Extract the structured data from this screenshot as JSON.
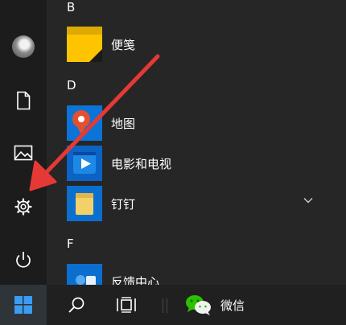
{
  "start_menu": {
    "sections": [
      {
        "letter": "B",
        "apps": [
          {
            "label": "便笺",
            "icon": "sticky-notes-icon",
            "tile_color": "#ffc400"
          }
        ]
      },
      {
        "letter": "D",
        "apps": [
          {
            "label": "地图",
            "icon": "maps-icon",
            "tile_color": "#0b74d6"
          },
          {
            "label": "电影和电视",
            "icon": "movies-tv-icon",
            "tile_color": "#0b63c5"
          },
          {
            "label": "钉钉",
            "icon": "folder-icon",
            "tile_color": "#0b6fd0",
            "expandable": true
          }
        ]
      },
      {
        "letter": "F",
        "apps": [
          {
            "label": "反馈中心",
            "icon": "feedback-hub-icon",
            "tile_color": "#0b6fd0"
          }
        ]
      }
    ]
  },
  "left_rail": [
    "user-avatar",
    "documents-icon",
    "pictures-icon",
    "settings-icon",
    "power-icon"
  ],
  "taskbar": {
    "wechat_label": "微信"
  },
  "annotation": {
    "color": "#e53935",
    "points_to": "settings-icon"
  }
}
